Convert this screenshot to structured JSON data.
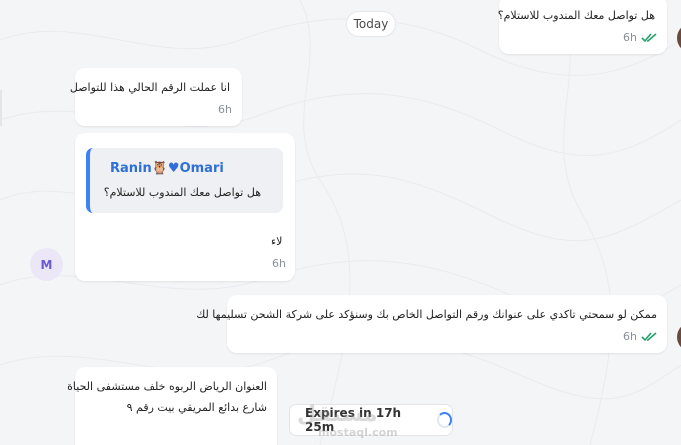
{
  "chat": {
    "date_label": "Today",
    "messages": [
      {
        "direction": "outgoing",
        "text": "هل تواصل معك المندوب للاستلام؟",
        "time": "6h",
        "status": "read"
      },
      {
        "direction": "incoming",
        "text": "انا عملت الرقم الحالي هذا للتواصل",
        "time": "6h"
      },
      {
        "direction": "incoming",
        "reply_to": {
          "author": "Ranin🦉♥Omari",
          "text": "هل تواصل معك المندوب للاستلام؟"
        },
        "text": "لاء",
        "time": "6h"
      },
      {
        "direction": "outgoing",
        "text": "ممكن لو سمحتي تاكدي على عنوانك ورقم التواصل الخاص بك وسنؤكد على شركة الشحن تسليمها لك",
        "time": "6h",
        "status": "read"
      },
      {
        "direction": "incoming",
        "lines": [
          "العنوان الرياض الربوه خلف مستشفى الحياة",
          "شارع بدائع المريقي بيت رقم ٩"
        ]
      }
    ],
    "contact_avatar_initial": "M",
    "expiry_label": "Expires in 17h 25m",
    "watermark": {
      "logo_text": "مستقل",
      "domain": "mostaql.com"
    }
  },
  "colors": {
    "background": "#f4f5f7",
    "bubble": "#ffffff",
    "accent_blue": "#3b82f6",
    "read_tick": "#22a06b",
    "avatar_m_bg": "#ebe7f7",
    "avatar_m_text": "#6b5bd3"
  },
  "icons": [
    "double-check-icon",
    "spinner-icon"
  ]
}
